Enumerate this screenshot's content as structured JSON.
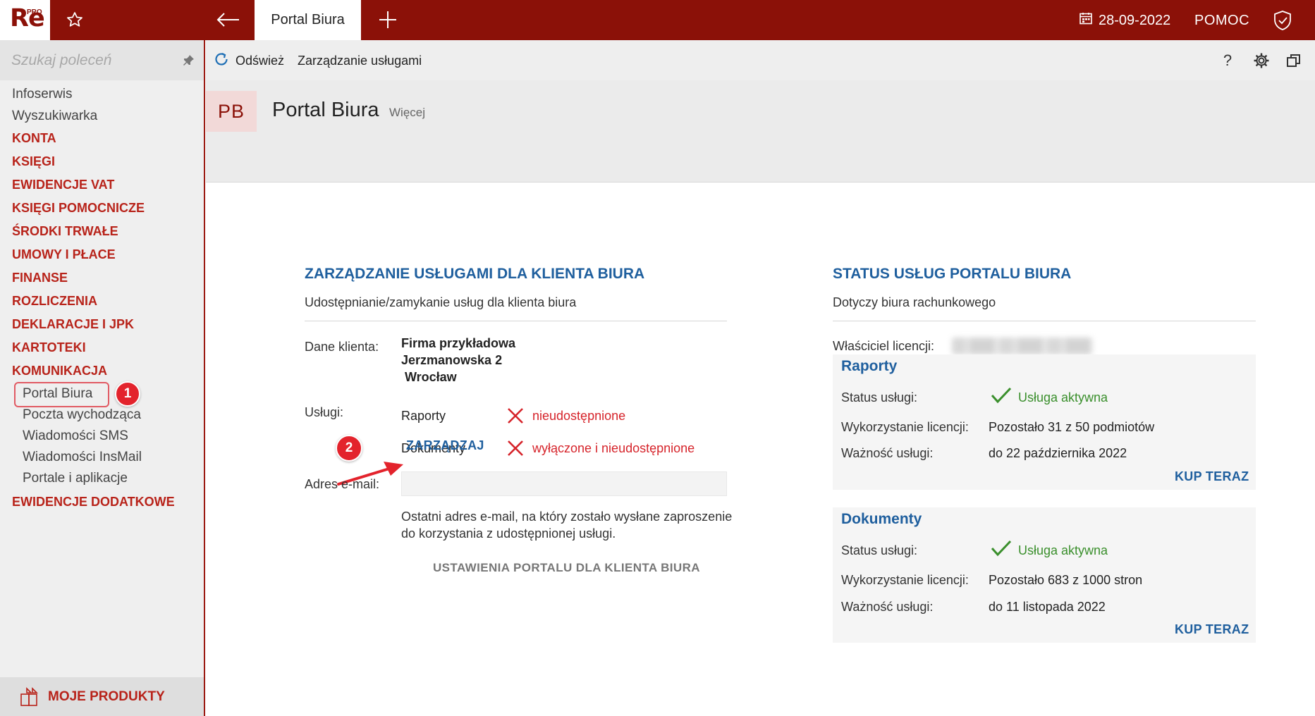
{
  "app": {
    "logo_text": "Re",
    "logo_badge": "PRO",
    "active_tab": "Portal Biura",
    "date": "28-09-2022",
    "help_label": "POMOC"
  },
  "sidebar": {
    "search_placeholder": "Szukaj poleceń",
    "items": [
      {
        "label": "Infoserwis",
        "kind": "plain"
      },
      {
        "label": "Wyszukiwarka",
        "kind": "plain"
      },
      {
        "label": "KONTA",
        "kind": "category"
      },
      {
        "label": "KSIĘGI",
        "kind": "category"
      },
      {
        "label": "EWIDENCJE VAT",
        "kind": "category"
      },
      {
        "label": "KSIĘGI POMOCNICZE",
        "kind": "category"
      },
      {
        "label": "ŚRODKI TRWAŁE",
        "kind": "category"
      },
      {
        "label": "UMOWY I PŁACE",
        "kind": "category"
      },
      {
        "label": "FINANSE",
        "kind": "category"
      },
      {
        "label": "ROZLICZENIA",
        "kind": "category"
      },
      {
        "label": "DEKLARACJE I JPK",
        "kind": "category"
      },
      {
        "label": "KARTOTEKI",
        "kind": "category"
      },
      {
        "label": "KOMUNIKACJA",
        "kind": "category"
      },
      {
        "label": "Portal Biura",
        "kind": "sub",
        "active": true
      },
      {
        "label": "Poczta wychodząca",
        "kind": "sub"
      },
      {
        "label": "Wiadomości SMS",
        "kind": "sub"
      },
      {
        "label": "Wiadomości InsMail",
        "kind": "sub"
      },
      {
        "label": "Portale i aplikacje",
        "kind": "sub"
      },
      {
        "label": "EWIDENCJE DODATKOWE",
        "kind": "category"
      }
    ],
    "bottom_label": "MOJE PRODUKTY"
  },
  "toolbar": {
    "refresh_label": "Odśwież",
    "manage_label": "Zarządzanie usługami",
    "help_glyph": "?"
  },
  "header": {
    "badge": "PB",
    "title": "Portal Biura",
    "more_label": "Więcej"
  },
  "left_section": {
    "title": "ZARZĄDZANIE USŁUGAMI DLA KLIENTA BIURA",
    "subtitle": "Udostępnianie/zamykanie usług dla klienta biura",
    "client_label": "Dane klienta:",
    "client_lines": [
      "Firma przykładowa",
      "Jerzmanowska 2",
      "Wrocław"
    ],
    "services_label": "Usługi:",
    "services": [
      {
        "name": "Raporty",
        "status": "nieudostępnione"
      },
      {
        "name": "Dokumenty",
        "status": "wyłączone i nieudostępnione"
      }
    ],
    "manage_link": "ZARZĄDZAJ",
    "email_label": "Adres e-mail:",
    "email_value": "",
    "note": "Ostatni adres e-mail, na który zostało wysłane zaproszenie do korzystania z udostępnionej usługi.",
    "settings_link": "USTAWIENIA PORTALU DLA KLIENTA BIURA"
  },
  "right_section": {
    "title": "STATUS USŁUG PORTALU BIURA",
    "subtitle": "Dotyczy biura rachunkowego",
    "owner_label": "Właściciel licencji:",
    "cards": [
      {
        "title": "Raporty",
        "status_label": "Status usługi:",
        "status_value": "Usługa aktywna",
        "usage_label": "Wykorzystanie licencji:",
        "usage_value": "Pozostało 31 z 50 podmiotów",
        "validity_label": "Ważność usługi:",
        "validity_value": "do 22 października 2022",
        "buy_label": "KUP TERAZ"
      },
      {
        "title": "Dokumenty",
        "status_label": "Status usługi:",
        "status_value": "Usługa aktywna",
        "usage_label": "Wykorzystanie licencji:",
        "usage_value": "Pozostało 683 z 1000 stron",
        "validity_label": "Ważność usługi:",
        "validity_value": "do 11 listopada 2022",
        "buy_label": "KUP TERAZ"
      }
    ]
  },
  "annotations": {
    "badge_1": "1",
    "badge_2": "2"
  },
  "colors": {
    "brand": "#8b1108",
    "category": "#b8231a",
    "link": "#1f5f9e",
    "error": "#d6232a",
    "success": "#3a8f2c",
    "annotation": "#e3232c"
  }
}
